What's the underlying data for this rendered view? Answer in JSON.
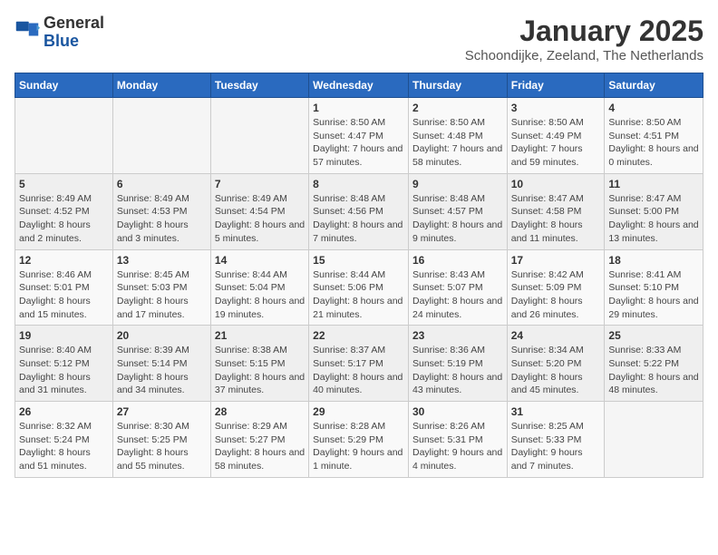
{
  "header": {
    "logo": {
      "general": "General",
      "blue": "Blue"
    },
    "title": "January 2025",
    "subtitle": "Schoondijke, Zeeland, The Netherlands"
  },
  "weekdays": [
    "Sunday",
    "Monday",
    "Tuesday",
    "Wednesday",
    "Thursday",
    "Friday",
    "Saturday"
  ],
  "weeks": [
    [
      {
        "day": "",
        "sunrise": "",
        "sunset": "",
        "daylight": ""
      },
      {
        "day": "",
        "sunrise": "",
        "sunset": "",
        "daylight": ""
      },
      {
        "day": "",
        "sunrise": "",
        "sunset": "",
        "daylight": ""
      },
      {
        "day": "1",
        "sunrise": "Sunrise: 8:50 AM",
        "sunset": "Sunset: 4:47 PM",
        "daylight": "Daylight: 7 hours and 57 minutes."
      },
      {
        "day": "2",
        "sunrise": "Sunrise: 8:50 AM",
        "sunset": "Sunset: 4:48 PM",
        "daylight": "Daylight: 7 hours and 58 minutes."
      },
      {
        "day": "3",
        "sunrise": "Sunrise: 8:50 AM",
        "sunset": "Sunset: 4:49 PM",
        "daylight": "Daylight: 7 hours and 59 minutes."
      },
      {
        "day": "4",
        "sunrise": "Sunrise: 8:50 AM",
        "sunset": "Sunset: 4:51 PM",
        "daylight": "Daylight: 8 hours and 0 minutes."
      }
    ],
    [
      {
        "day": "5",
        "sunrise": "Sunrise: 8:49 AM",
        "sunset": "Sunset: 4:52 PM",
        "daylight": "Daylight: 8 hours and 2 minutes."
      },
      {
        "day": "6",
        "sunrise": "Sunrise: 8:49 AM",
        "sunset": "Sunset: 4:53 PM",
        "daylight": "Daylight: 8 hours and 3 minutes."
      },
      {
        "day": "7",
        "sunrise": "Sunrise: 8:49 AM",
        "sunset": "Sunset: 4:54 PM",
        "daylight": "Daylight: 8 hours and 5 minutes."
      },
      {
        "day": "8",
        "sunrise": "Sunrise: 8:48 AM",
        "sunset": "Sunset: 4:56 PM",
        "daylight": "Daylight: 8 hours and 7 minutes."
      },
      {
        "day": "9",
        "sunrise": "Sunrise: 8:48 AM",
        "sunset": "Sunset: 4:57 PM",
        "daylight": "Daylight: 8 hours and 9 minutes."
      },
      {
        "day": "10",
        "sunrise": "Sunrise: 8:47 AM",
        "sunset": "Sunset: 4:58 PM",
        "daylight": "Daylight: 8 hours and 11 minutes."
      },
      {
        "day": "11",
        "sunrise": "Sunrise: 8:47 AM",
        "sunset": "Sunset: 5:00 PM",
        "daylight": "Daylight: 8 hours and 13 minutes."
      }
    ],
    [
      {
        "day": "12",
        "sunrise": "Sunrise: 8:46 AM",
        "sunset": "Sunset: 5:01 PM",
        "daylight": "Daylight: 8 hours and 15 minutes."
      },
      {
        "day": "13",
        "sunrise": "Sunrise: 8:45 AM",
        "sunset": "Sunset: 5:03 PM",
        "daylight": "Daylight: 8 hours and 17 minutes."
      },
      {
        "day": "14",
        "sunrise": "Sunrise: 8:44 AM",
        "sunset": "Sunset: 5:04 PM",
        "daylight": "Daylight: 8 hours and 19 minutes."
      },
      {
        "day": "15",
        "sunrise": "Sunrise: 8:44 AM",
        "sunset": "Sunset: 5:06 PM",
        "daylight": "Daylight: 8 hours and 21 minutes."
      },
      {
        "day": "16",
        "sunrise": "Sunrise: 8:43 AM",
        "sunset": "Sunset: 5:07 PM",
        "daylight": "Daylight: 8 hours and 24 minutes."
      },
      {
        "day": "17",
        "sunrise": "Sunrise: 8:42 AM",
        "sunset": "Sunset: 5:09 PM",
        "daylight": "Daylight: 8 hours and 26 minutes."
      },
      {
        "day": "18",
        "sunrise": "Sunrise: 8:41 AM",
        "sunset": "Sunset: 5:10 PM",
        "daylight": "Daylight: 8 hours and 29 minutes."
      }
    ],
    [
      {
        "day": "19",
        "sunrise": "Sunrise: 8:40 AM",
        "sunset": "Sunset: 5:12 PM",
        "daylight": "Daylight: 8 hours and 31 minutes."
      },
      {
        "day": "20",
        "sunrise": "Sunrise: 8:39 AM",
        "sunset": "Sunset: 5:14 PM",
        "daylight": "Daylight: 8 hours and 34 minutes."
      },
      {
        "day": "21",
        "sunrise": "Sunrise: 8:38 AM",
        "sunset": "Sunset: 5:15 PM",
        "daylight": "Daylight: 8 hours and 37 minutes."
      },
      {
        "day": "22",
        "sunrise": "Sunrise: 8:37 AM",
        "sunset": "Sunset: 5:17 PM",
        "daylight": "Daylight: 8 hours and 40 minutes."
      },
      {
        "day": "23",
        "sunrise": "Sunrise: 8:36 AM",
        "sunset": "Sunset: 5:19 PM",
        "daylight": "Daylight: 8 hours and 43 minutes."
      },
      {
        "day": "24",
        "sunrise": "Sunrise: 8:34 AM",
        "sunset": "Sunset: 5:20 PM",
        "daylight": "Daylight: 8 hours and 45 minutes."
      },
      {
        "day": "25",
        "sunrise": "Sunrise: 8:33 AM",
        "sunset": "Sunset: 5:22 PM",
        "daylight": "Daylight: 8 hours and 48 minutes."
      }
    ],
    [
      {
        "day": "26",
        "sunrise": "Sunrise: 8:32 AM",
        "sunset": "Sunset: 5:24 PM",
        "daylight": "Daylight: 8 hours and 51 minutes."
      },
      {
        "day": "27",
        "sunrise": "Sunrise: 8:30 AM",
        "sunset": "Sunset: 5:25 PM",
        "daylight": "Daylight: 8 hours and 55 minutes."
      },
      {
        "day": "28",
        "sunrise": "Sunrise: 8:29 AM",
        "sunset": "Sunset: 5:27 PM",
        "daylight": "Daylight: 8 hours and 58 minutes."
      },
      {
        "day": "29",
        "sunrise": "Sunrise: 8:28 AM",
        "sunset": "Sunset: 5:29 PM",
        "daylight": "Daylight: 9 hours and 1 minute."
      },
      {
        "day": "30",
        "sunrise": "Sunrise: 8:26 AM",
        "sunset": "Sunset: 5:31 PM",
        "daylight": "Daylight: 9 hours and 4 minutes."
      },
      {
        "day": "31",
        "sunrise": "Sunrise: 8:25 AM",
        "sunset": "Sunset: 5:33 PM",
        "daylight": "Daylight: 9 hours and 7 minutes."
      },
      {
        "day": "",
        "sunrise": "",
        "sunset": "",
        "daylight": ""
      }
    ]
  ]
}
